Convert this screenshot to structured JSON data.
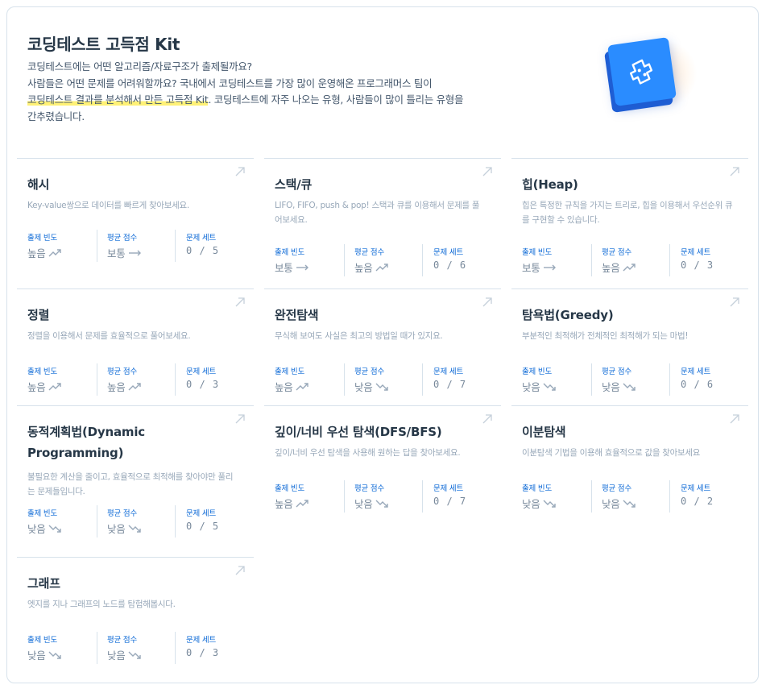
{
  "hero": {
    "title": "코딩테스트 고득점 Kit",
    "line1": "코딩테스트에는 어떤 알고리즘/자료구조가 출제될까요?",
    "line2": "사람들은 어떤 문제를 어려워할까요? 국내에서 코딩테스트를 가장 많이 운영해온 프로그래머스 팀이",
    "line3_highlight": "코딩테스트 결과를 분석해서 만든 고득점 Kit",
    "line3_rest": ". 코딩테스트에 자주 나오는 유형, 사람들이 많이 틀리는 유형을",
    "line4": "간추렸습니다.",
    "logo_icon": "puzzle-book-icon",
    "logo_color": "#2a8cff"
  },
  "labels": {
    "frequency": "출제 빈도",
    "avg_score": "평균 점수",
    "problem_set": "문제 세트"
  },
  "colors": {
    "accent": "#0b68d6",
    "trend_up": "#98a8b9",
    "border": "#d7e2eb"
  },
  "cards": [
    {
      "title": "해시",
      "desc": "Key-value쌍으로 데이터를 빠르게 찾아보세요.",
      "frequency": "높음",
      "frequency_trend": "up",
      "avg_score": "보통",
      "avg_score_trend": "flat",
      "problem_set": "0 / 5"
    },
    {
      "title": "스택/큐",
      "desc": "LIFO, FIFO, push & pop! 스택과 큐를 이용해서 문제를 풀어보세요.",
      "frequency": "보통",
      "frequency_trend": "flat",
      "avg_score": "높음",
      "avg_score_trend": "up",
      "problem_set": "0 / 6"
    },
    {
      "title": "힙(Heap)",
      "desc": "힙은 특정한 규칙을 가지는 트리로, 힙을 이용해서 우선순위 큐를 구현할 수 있습니다.",
      "frequency": "보통",
      "frequency_trend": "flat",
      "avg_score": "높음",
      "avg_score_trend": "up",
      "problem_set": "0 / 3"
    },
    {
      "title": "정렬",
      "desc": "정렬을 이용해서 문제를 효율적으로 풀어보세요.",
      "frequency": "높음",
      "frequency_trend": "up",
      "avg_score": "높음",
      "avg_score_trend": "up",
      "problem_set": "0 / 3"
    },
    {
      "title": "완전탐색",
      "desc": "무식해 보여도 사실은 최고의 방법일 때가 있지요.",
      "frequency": "높음",
      "frequency_trend": "up",
      "avg_score": "낮음",
      "avg_score_trend": "down",
      "problem_set": "0 / 7"
    },
    {
      "title": "탐욕법(Greedy)",
      "desc": "부분적인 최적해가 전체적인 최적해가 되는 마법!",
      "frequency": "낮음",
      "frequency_trend": "down",
      "avg_score": "낮음",
      "avg_score_trend": "down",
      "problem_set": "0 / 6"
    },
    {
      "title": "동적계획법(Dynamic Programming)",
      "desc": "불필요한 계산을 줄이고, 효율적으로 최적해를 찾아야만 풀리는 문제들입니다.",
      "frequency": "낮음",
      "frequency_trend": "down",
      "avg_score": "낮음",
      "avg_score_trend": "down",
      "problem_set": "0 / 5"
    },
    {
      "title": "깊이/너비 우선 탐색(DFS/BFS)",
      "desc": "깊이/너비 우선 탐색을 사용해 원하는 답을 찾아보세요.",
      "frequency": "높음",
      "frequency_trend": "up",
      "avg_score": "낮음",
      "avg_score_trend": "down",
      "problem_set": "0 / 7"
    },
    {
      "title": "이분탐색",
      "desc": "이분탐색 기법을 이용해 효율적으로 값을 찾아보세요",
      "frequency": "낮음",
      "frequency_trend": "down",
      "avg_score": "낮음",
      "avg_score_trend": "down",
      "problem_set": "0 / 2"
    },
    {
      "title": "그래프",
      "desc": "엣지를 지나 그래프의 노드를 탐험해봅시다.",
      "frequency": "낮음",
      "frequency_trend": "down",
      "avg_score": "낮음",
      "avg_score_trend": "down",
      "problem_set": "0 / 3"
    }
  ]
}
